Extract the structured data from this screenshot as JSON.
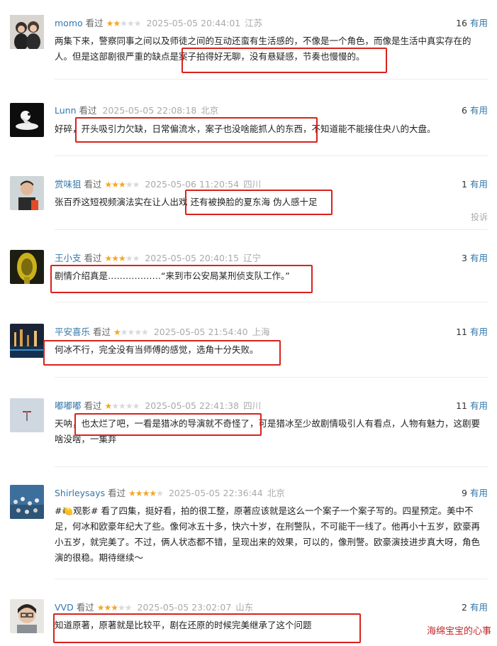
{
  "reviews": [
    {
      "name": "momo",
      "watched": "看过",
      "stars": 2,
      "date": "2025-05-05 20:44:01",
      "location": "江苏",
      "useful_count": "16",
      "useful_label": "有用",
      "text": "两集下来，警察同事之间以及师徒之间的互动还蛮有生活感的，不像是一个角色，而像是生活中真实存在的人。但是这部剧很严重的缺点是案子拍得好无聊，没有悬疑感，节奏也慢慢的。"
    },
    {
      "name": "Lunn",
      "watched": "看过",
      "stars": 0,
      "date": "2025-05-05 22:08:18",
      "location": "北京",
      "useful_count": "6",
      "useful_label": "有用",
      "text": "好碎，开头吸引力欠缺，日常偏流水，案子也没啥能抓人的东西，不知道能不能接住央八的大盘。"
    },
    {
      "name": "赏味狙",
      "watched": "看过",
      "stars": 3,
      "date": "2025-05-06 11:20:54",
      "location": "四川",
      "useful_count": "1",
      "useful_label": "有用",
      "text": "张百乔这短视频演法实在让人出戏 还有被换脸的夏东海 伪人感十足",
      "report": "投诉"
    },
    {
      "name": "王小支",
      "watched": "看过",
      "stars": 3,
      "date": "2025-05-05 20:40:15",
      "location": "辽宁",
      "useful_count": "3",
      "useful_label": "有用",
      "text": "剧情介绍真是………………“来到市公安局某刑侦支队工作。”"
    },
    {
      "name": "平安喜乐",
      "watched": "看过",
      "stars": 1,
      "date": "2025-05-05 21:54:40",
      "location": "上海",
      "useful_count": "11",
      "useful_label": "有用",
      "text": "何冰不行，完全没有当师傅的感觉，选角十分失败。"
    },
    {
      "name": "嘟嘟嘟",
      "watched": "看过",
      "stars": 1,
      "date": "2025-05-05 22:41:38",
      "location": "四川",
      "useful_count": "11",
      "useful_label": "有用",
      "text": "天呐，也太烂了吧，一看是猎冰的导演就不奇怪了，可是猎冰至少故剧情吸引人有看点，人物有魅力，这剧要啥没啥，一集弃"
    },
    {
      "name": "Shirleysays",
      "watched": "看过",
      "stars": 4,
      "date": "2025-05-05 22:36:44",
      "location": "北京",
      "useful_count": "9",
      "useful_label": "有用",
      "text": "#🍋观影# 看了四集，挺好看，拍的很工整，原著应该就是这么一个案子一个案子写的。四星预定。美中不足，何冰和欧豪年纪大了些。像何冰五十多，快六十岁，在刑警队，不可能干一线了。他再小十五岁，欧豪再小五岁，就完美了。不过，俩人状态都不错，呈现出来的效果，可以的，像刑警。欧豪演技进步真大呀，角色演的很稳。期待继续～"
    },
    {
      "name": "VVD",
      "watched": "看过",
      "stars": 3,
      "date": "2025-05-05 23:02:07",
      "location": "山东",
      "useful_count": "2",
      "useful_label": "有用",
      "text": "知道原著，原著就是比较平，剧在还原的时候完美继承了这个问题"
    }
  ],
  "watermark": "海绵宝宝的心事",
  "colors": {
    "link": "#3377aa",
    "star": "#f5a623",
    "highlight": "#d9221c"
  }
}
